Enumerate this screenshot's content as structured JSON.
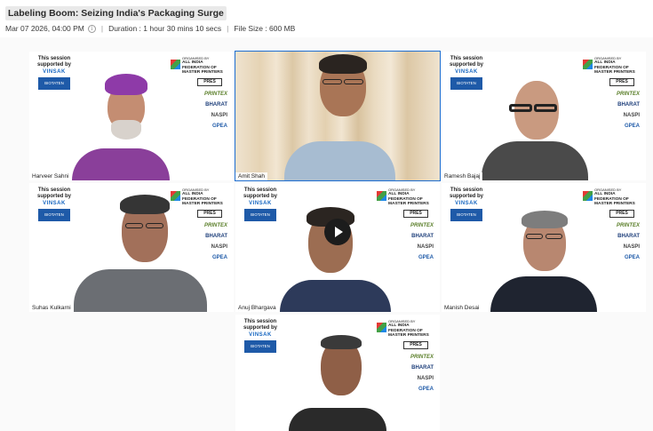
{
  "header": {
    "title": "Labeling Boom: Seizing India's Packaging Surge",
    "date": "Mar 07 2026, 04:00 PM",
    "info_icon": "i",
    "duration": "Duration : 1 hour 30 mins 10 secs",
    "file_size": "File Size : 600 MB"
  },
  "overlay": {
    "sponsor_line1": "This session",
    "sponsor_line2": "supported by",
    "sponsor_brand": "VINSAK",
    "sponsor_badge": "BIOTATEN",
    "org_organised_by": "ORGANISED BY",
    "org_name1": "ALL INDIA",
    "org_name2": "FEDERATION OF",
    "org_name3": "MASTER PRINTERS",
    "org_pres": "PRES",
    "logo_printex": "PRINTEX",
    "logo_bharat": "BHARAT",
    "logo_naspi": "NASPI",
    "logo_gpea": "GPEA"
  },
  "participants": [
    {
      "name": "Harveer Sahni"
    },
    {
      "name": "Amit Shah"
    },
    {
      "name": "Ramesh Bajaj"
    },
    {
      "name": "Suhas Kulkarni"
    },
    {
      "name": "Anuj Bhargava"
    },
    {
      "name": "Manish Desai"
    },
    {
      "name": ""
    }
  ],
  "colors": {
    "active_border": "#1f6fd1",
    "sponsor_brand": "#1565c0"
  }
}
